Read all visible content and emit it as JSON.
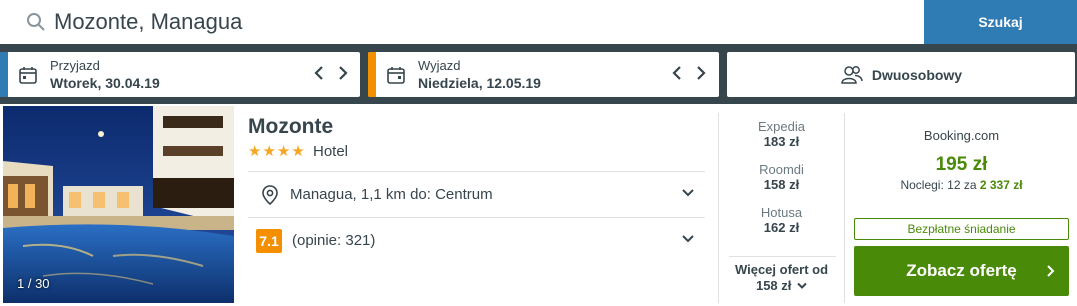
{
  "search": {
    "value": "Mozonte, Managua",
    "button_label": "Szukaj",
    "icon": "search-icon"
  },
  "checkin": {
    "label": "Przyjazd",
    "value": "Wtorek, 30.04.19",
    "accent_color": "#2f7bb3"
  },
  "checkout": {
    "label": "Wyjazd",
    "value": "Niedziela, 12.05.19",
    "accent_color": "#f48f00"
  },
  "guests": {
    "label": "Dwuosobowy",
    "icon": "people-icon"
  },
  "hotel": {
    "photo_counter": "1 / 30",
    "name": "Mozonte",
    "stars": "★★★★",
    "type": "Hotel",
    "location": "Managua, 1,1 km do: Centrum",
    "rating": "7.1",
    "reviews": "(opinie: 321)"
  },
  "offers": [
    {
      "site": "Expedia",
      "price": "183 zł"
    },
    {
      "site": "Roomdi",
      "price": "158 zł"
    },
    {
      "site": "Hotusa",
      "price": "162 zł"
    }
  ],
  "more_offers": {
    "line1": "Więcej ofert od",
    "line2": "158 zł"
  },
  "deal": {
    "site": "Booking.com",
    "price": "195 zł",
    "nights_prefix": "Noclegi: 12 za ",
    "total": "2 337 zł",
    "badge": "Bezpłatne śniadanie",
    "button_label": "Zobacz ofertę"
  },
  "colors": {
    "primary": "#2f7bb3",
    "deal_green": "#4a8a09",
    "rating_orange": "#f48f00",
    "background": "#37454d"
  }
}
